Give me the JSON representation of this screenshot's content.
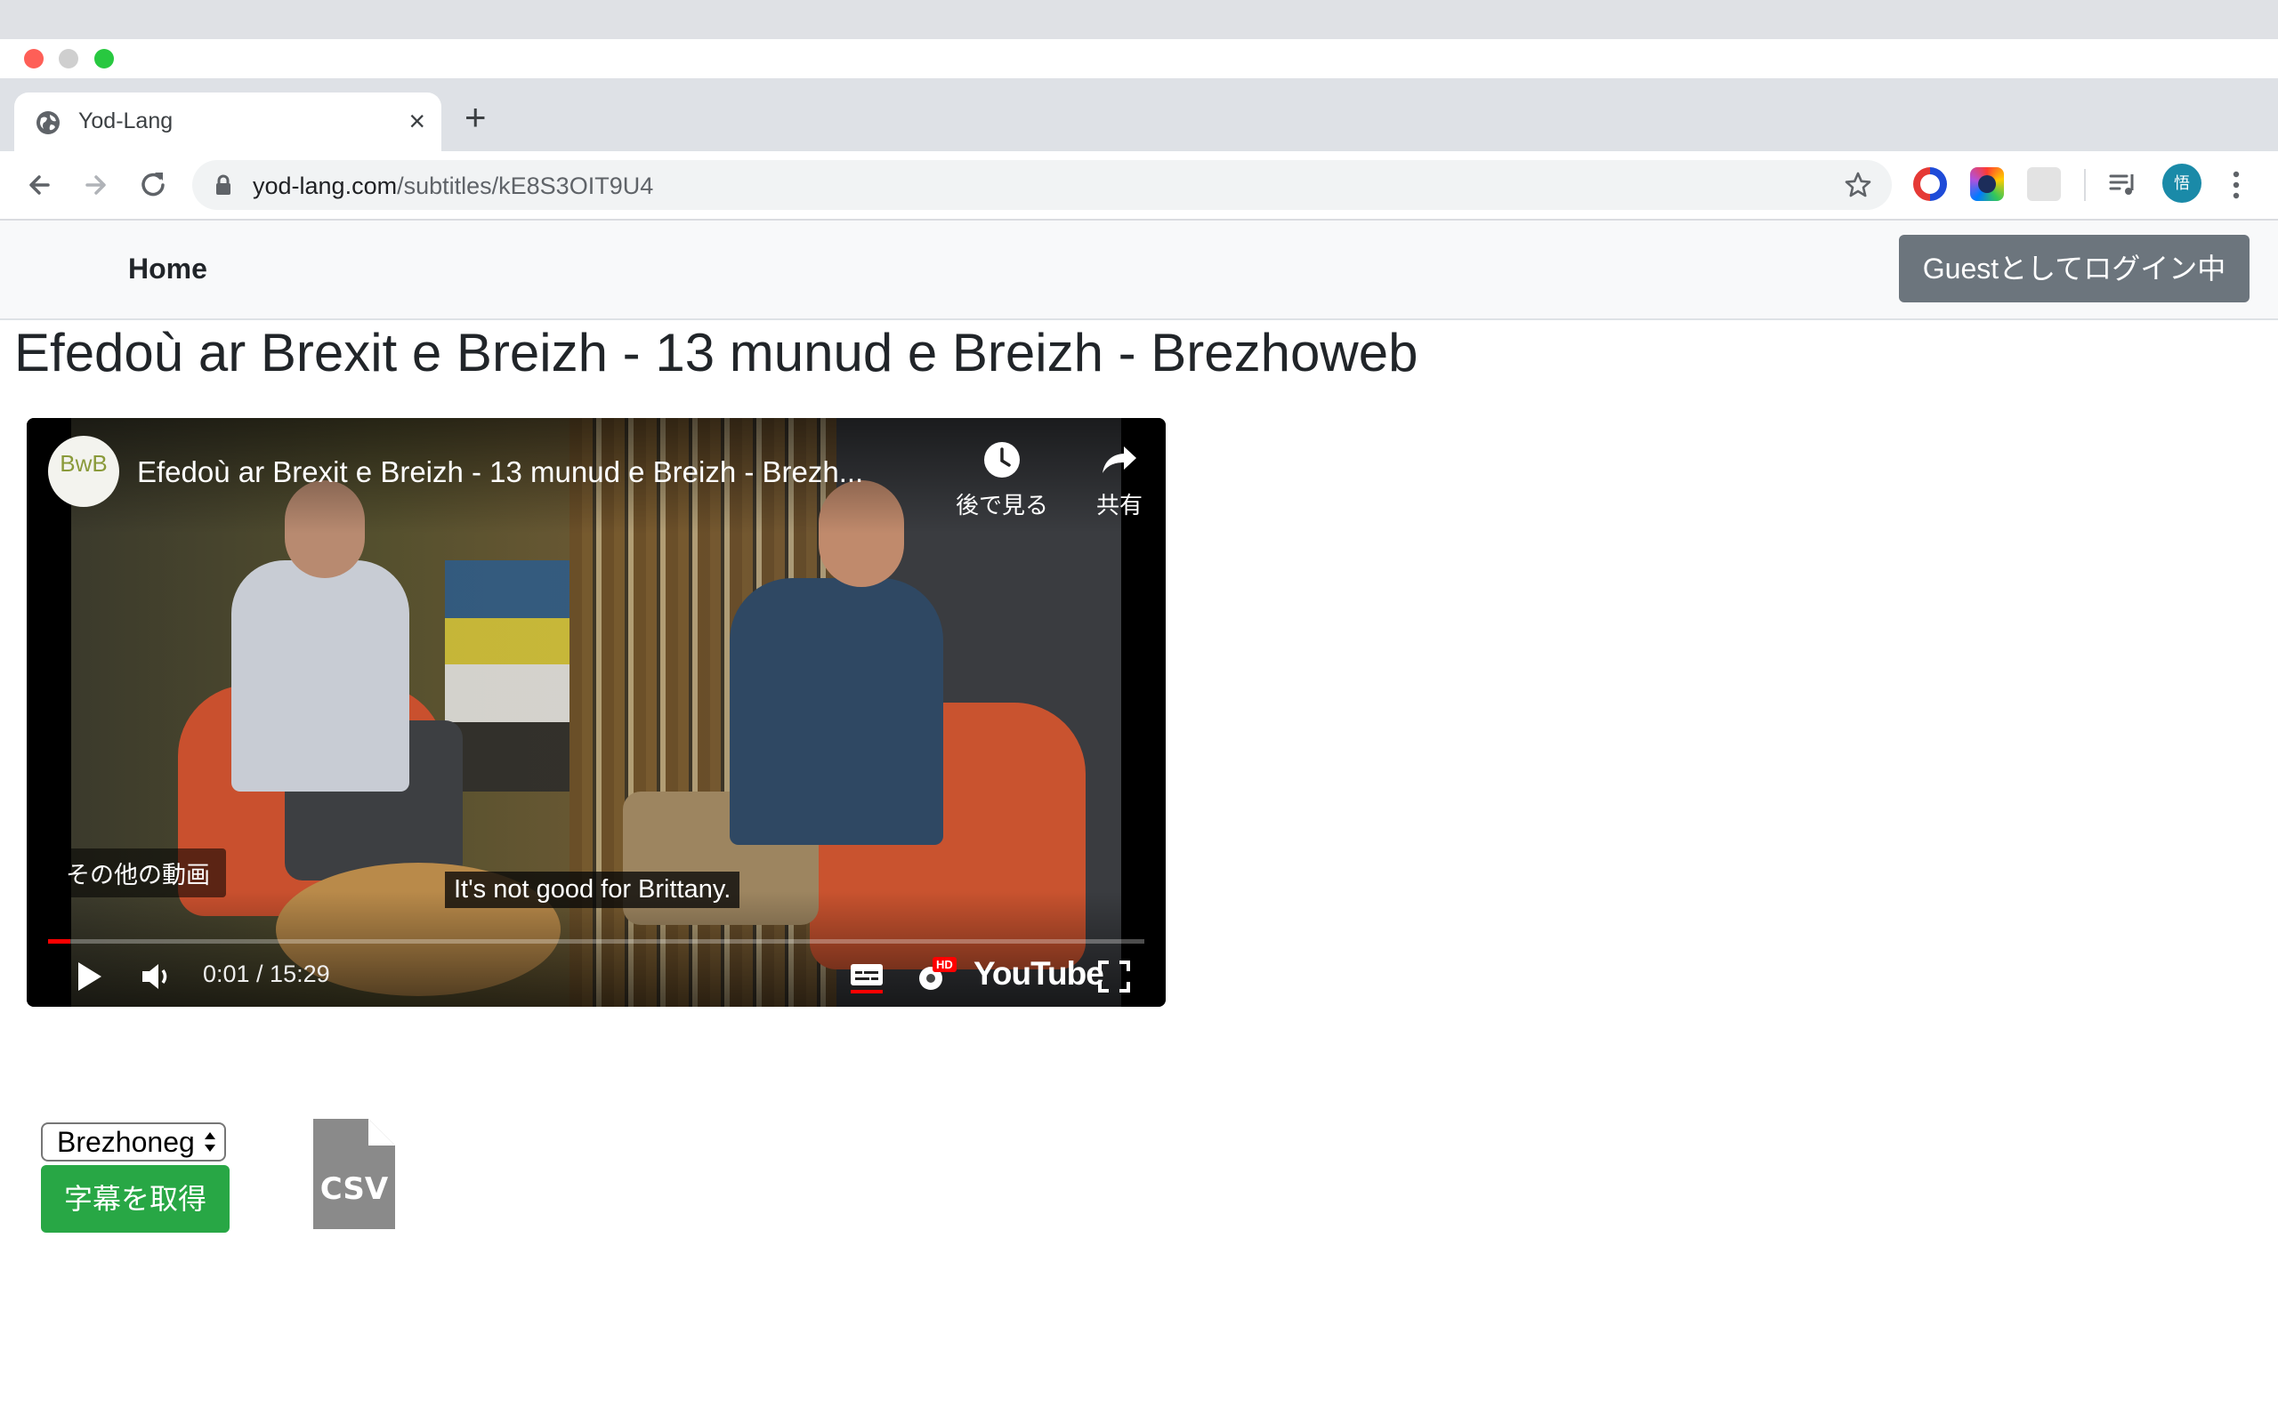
{
  "browser": {
    "tab_title": "Yod-Lang",
    "tab_close": "×",
    "new_tab": "+",
    "url_host": "yod-lang.com",
    "url_path": "/subtitles/kE8S3OIT9U4",
    "profile_initial": "悟"
  },
  "navbar": {
    "home_label": "Home",
    "guest_label": "Guestとしてログイン中"
  },
  "page": {
    "title": "Efedoù ar Brexit e Breizh - 13 munud e Breizh - Brezhoweb"
  },
  "video": {
    "channel_logo_text": "BwB",
    "title": "Efedoù ar Brexit e Breizh - 13 munud e Breizh - Brezh...",
    "watch_later_label": "後で見る",
    "share_label": "共有",
    "more_videos_label": "その他の動画",
    "caption": "It's not good for Brittany.",
    "current_time": "0:01",
    "duration": "15:29",
    "time_display": "0:01 / 15:29",
    "progress_fraction": 0.02,
    "hd_badge": "HD",
    "brand": "YouTube",
    "progress_color": "#ff0000"
  },
  "controls": {
    "language_selected": "Brezhoneg",
    "get_subtitles_label": "字幕を取得",
    "csv_label": "CSV",
    "button_color": "#28a745"
  }
}
